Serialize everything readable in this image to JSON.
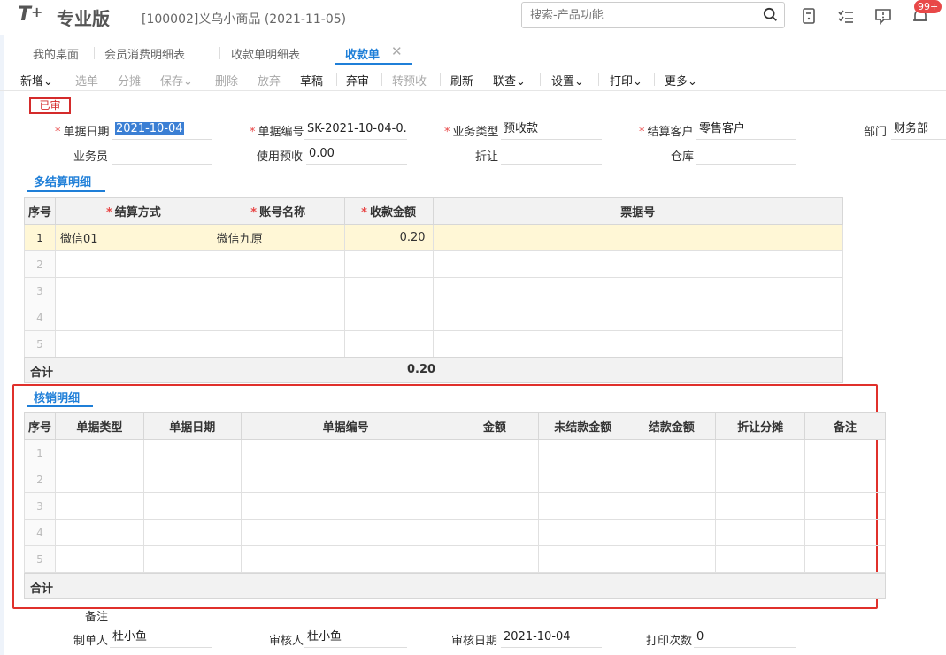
{
  "header": {
    "logo": "T",
    "logo_plus": "+",
    "product": "专业版",
    "company": "[100002]义乌小商品  (2021-11-05)",
    "search_placeholder": "搜索-产品功能",
    "badge": "99+"
  },
  "tabs": [
    {
      "label": "我的桌面"
    },
    {
      "label": "会员消费明细表"
    },
    {
      "label": "收款单明细表"
    },
    {
      "label": "收款单"
    }
  ],
  "toolbar": {
    "new": "新增",
    "select": "选单",
    "split": "分摊",
    "save": "保存",
    "delete": "删除",
    "discard": "放弃",
    "draft": "草稿",
    "unaudit": "弃审",
    "to_prepay": "转预收",
    "refresh": "刷新",
    "linked": "联查",
    "settings": "设置",
    "print": "打印",
    "more": "更多"
  },
  "status_stamp": "已审",
  "form": {
    "date_label": "单据日期",
    "date_value": "2021-10-04",
    "number_label": "单据编号",
    "number_value": "SK-2021-10-04-0...",
    "biz_type_label": "业务类型",
    "biz_type_value": "预收款",
    "customer_label": "结算客户",
    "customer_value": "零售客户",
    "dept_label": "部门",
    "dept_value": "财务部",
    "salesman_label": "业务员",
    "salesman_value": "",
    "use_prepay_label": "使用预收",
    "use_prepay_value": "0.00",
    "discount_label": "折让",
    "discount_value": "",
    "warehouse_label": "仓库",
    "warehouse_value": ""
  },
  "settlement": {
    "title": "多结算明细",
    "columns": [
      "序号",
      "结算方式",
      "账号名称",
      "收款金额",
      "票据号"
    ],
    "rows": [
      {
        "no": "1",
        "method": "微信01",
        "account": "微信九原",
        "amount": "0.20",
        "ticket": ""
      },
      {
        "no": "2",
        "method": "",
        "account": "",
        "amount": "",
        "ticket": ""
      },
      {
        "no": "3",
        "method": "",
        "account": "",
        "amount": "",
        "ticket": ""
      },
      {
        "no": "4",
        "method": "",
        "account": "",
        "amount": "",
        "ticket": ""
      },
      {
        "no": "5",
        "method": "",
        "account": "",
        "amount": "",
        "ticket": ""
      }
    ],
    "total_label": "合计",
    "total_value": "0.20"
  },
  "writeoff": {
    "title": "核销明细",
    "columns": [
      "序号",
      "单据类型",
      "单据日期",
      "单据编号",
      "金额",
      "未结款金额",
      "结款金额",
      "折让分摊",
      "备注"
    ],
    "rows": [
      {
        "no": "1"
      },
      {
        "no": "2"
      },
      {
        "no": "3"
      },
      {
        "no": "4"
      },
      {
        "no": "5"
      }
    ],
    "total_label": "合计"
  },
  "footer": {
    "remark_label": "备注",
    "maker_label": "制单人",
    "maker_value": "杜小鱼",
    "auditor_label": "审核人",
    "auditor_value": "杜小鱼",
    "audit_date_label": "审核日期",
    "audit_date_value": "2021-10-04",
    "print_count_label": "打印次数",
    "print_count_value": "0"
  }
}
